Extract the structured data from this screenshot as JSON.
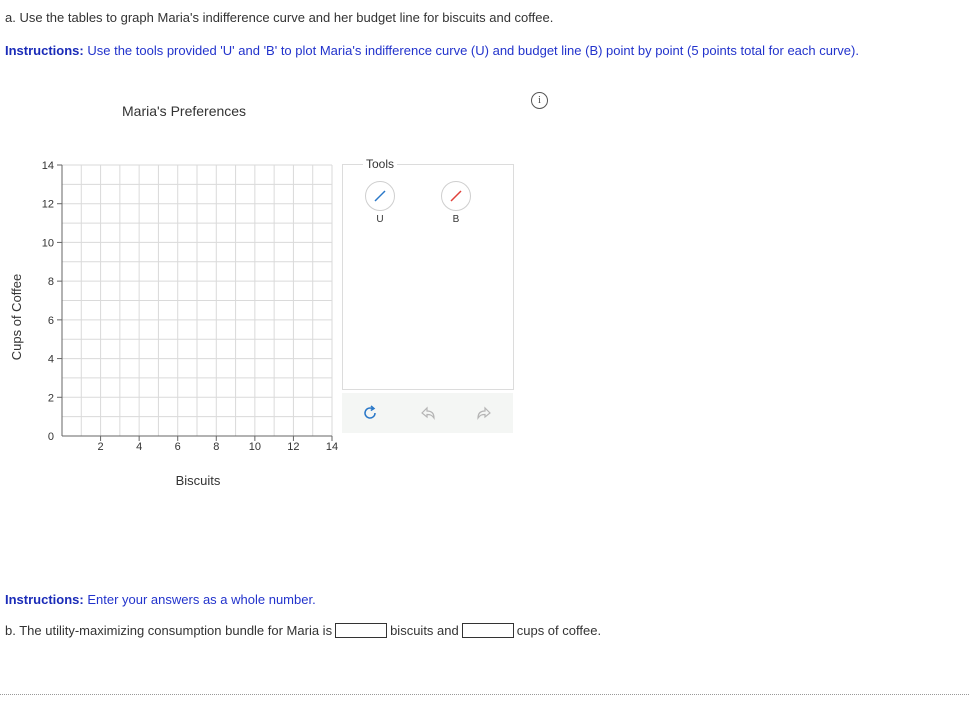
{
  "part_a": {
    "text": "a. Use the tables to graph Maria's indifference curve and her budget line for biscuits and coffee."
  },
  "instructions_a": {
    "label": "Instructions:",
    "text": " Use the tools provided 'U' and 'B' to plot Maria's indifference curve (U) and budget line (B) point by point (5 points total for each curve)."
  },
  "info_icon": {
    "glyph": "i",
    "icon": "info-icon"
  },
  "chart": {
    "title": "Maria's Preferences",
    "xlabel": "Biscuits",
    "ylabel": "Cups of Coffee",
    "origin_label": "0"
  },
  "chart_data": {
    "type": "scatter",
    "title": "Maria's Preferences",
    "xlabel": "Biscuits",
    "ylabel": "Cups of Coffee",
    "xlim": [
      0,
      14
    ],
    "ylim": [
      0,
      14
    ],
    "x_ticks": [
      2,
      4,
      6,
      8,
      10,
      12,
      14
    ],
    "y_ticks": [
      2,
      4,
      6,
      8,
      10,
      12,
      14
    ],
    "minor_grid_step": 1,
    "grid": true,
    "series": []
  },
  "tools": {
    "label": "Tools",
    "items": [
      {
        "label": "U",
        "color": "#2a78c8",
        "icon": "line-tool-icon"
      },
      {
        "label": "B",
        "color": "#e0403a",
        "icon": "line-tool-icon"
      }
    ]
  },
  "actions": {
    "reset_icon": "reset-icon",
    "undo_icon": "undo-icon",
    "redo_icon": "redo-icon",
    "reset_color": "#2a78c8",
    "disabled_color": "#b5b5b5"
  },
  "instructions_b": {
    "label": "Instructions:",
    "text": " Enter your answers as a whole number."
  },
  "part_b": {
    "prefix": "b. The utility-maximizing consumption bundle for Maria is",
    "biscuits_value": "",
    "middle": "biscuits and",
    "coffee_value": "",
    "suffix": "cups of coffee."
  },
  "colors": {
    "instruction_blue": "#2233cc",
    "grid": "#dadada"
  }
}
